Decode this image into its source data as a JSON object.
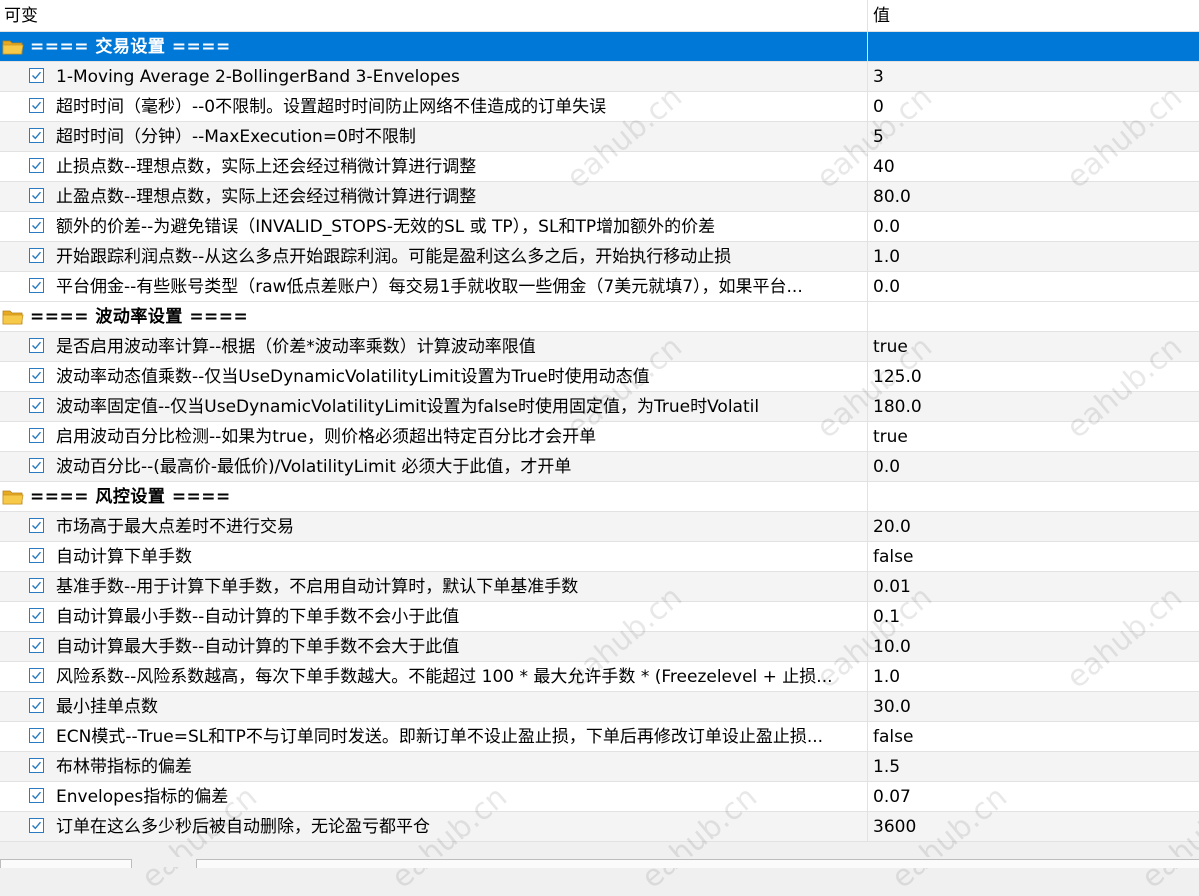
{
  "header": {
    "col1": "可变",
    "col2": "值"
  },
  "sections": [
    {
      "title": "==== 交易设置 ====",
      "params": [
        {
          "name": "1-Moving Average 2-BollingerBand 3-Envelopes",
          "value": "3"
        },
        {
          "name": "超时时间（毫秒）--0不限制。设置超时时间防止网络不佳造成的订单失误",
          "value": "0"
        },
        {
          "name": "超时时间（分钟）--MaxExecution=0时不限制",
          "value": "5"
        },
        {
          "name": "止损点数--理想点数，实际上还会经过稍微计算进行调整",
          "value": "40"
        },
        {
          "name": "止盈点数--理想点数，实际上还会经过稍微计算进行调整",
          "value": "80.0"
        },
        {
          "name": "额外的价差--为避免错误（INVALID_STOPS-无效的SL 或 TP），SL和TP增加额外的价差",
          "value": "0.0"
        },
        {
          "name": "开始跟踪利润点数--从这么多点开始跟踪利润。可能是盈利这么多之后，开始执行移动止损",
          "value": "1.0"
        },
        {
          "name": "平台佣金--有些账号类型（raw低点差账户）每交易1手就收取一些佣金（7美元就填7），如果平台...",
          "value": "0.0"
        }
      ]
    },
    {
      "title": "==== 波动率设置 ====",
      "params": [
        {
          "name": "是否启用波动率计算--根据（价差*波动率乘数）计算波动率限值",
          "value": "true"
        },
        {
          "name": "波动率动态值乘数--仅当UseDynamicVolatilityLimit设置为True时使用动态值",
          "value": "125.0"
        },
        {
          "name": "波动率固定值--仅当UseDynamicVolatilityLimit设置为false时使用固定值，为True时Volatil",
          "value": "180.0"
        },
        {
          "name": "启用波动百分比检测--如果为true，则价格必须超出特定百分比才会开单",
          "value": "true"
        },
        {
          "name": "波动百分比--(最高价-最低价)/VolatilityLimit 必须大于此值，才开单",
          "value": "0.0"
        }
      ]
    },
    {
      "title": "==== 风控设置 ====",
      "params": [
        {
          "name": "市场高于最大点差时不进行交易",
          "value": "20.0"
        },
        {
          "name": "自动计算下单手数",
          "value": "false"
        },
        {
          "name": "基准手数--用于计算下单手数，不启用自动计算时，默认下单基准手数",
          "value": "0.01"
        },
        {
          "name": "自动计算最小手数--自动计算的下单手数不会小于此值",
          "value": "0.1"
        },
        {
          "name": "自动计算最大手数--自动计算的下单手数不会大于此值",
          "value": "10.0"
        },
        {
          "name": "风险系数--风险系数越高，每次下单手数越大。不能超过 100 * 最大允许手数 * (Freezelevel + 止损...",
          "value": "1.0"
        },
        {
          "name": "最小挂单点数",
          "value": "30.0"
        },
        {
          "name": "ECN模式--True=SL和TP不与订单同时发送。即新订单不设止盈止损，下单后再修改订单设止盈止损...",
          "value": "false"
        },
        {
          "name": "布林带指标的偏差",
          "value": "1.5"
        },
        {
          "name": "Envelopes指标的偏差",
          "value": "0.07"
        },
        {
          "name": "订单在这么多少秒后被自动删除，无论盈亏都平仓",
          "value": "3600"
        }
      ]
    }
  ],
  "watermark": "eahub.cn",
  "colors": {
    "selected": "#0078d7",
    "checkbox": "#2a7bc0",
    "folder": "#f5c343"
  }
}
